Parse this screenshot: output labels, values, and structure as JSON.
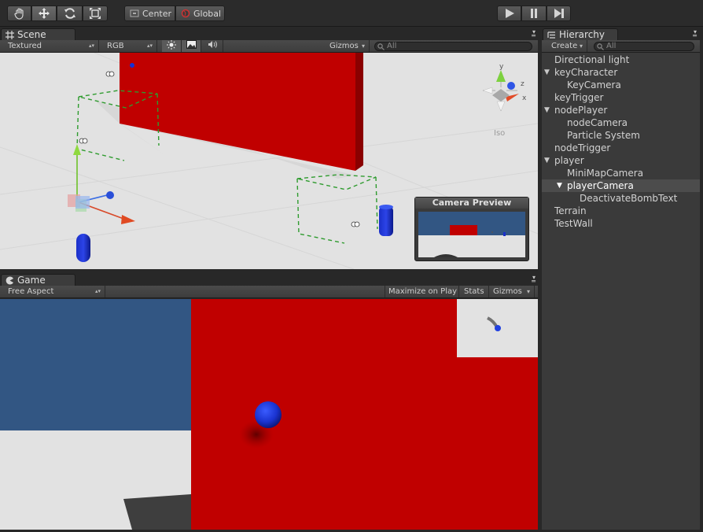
{
  "toolbar": {
    "tools": [
      {
        "name": "hand-tool",
        "icon": "hand-icon",
        "active": false
      },
      {
        "name": "move-tool",
        "icon": "move-arrows-icon",
        "active": true
      },
      {
        "name": "rotate-tool",
        "icon": "rotate-icon",
        "active": false
      },
      {
        "name": "scale-tool",
        "icon": "scale-icon",
        "active": false
      }
    ],
    "pivot_label": "Center",
    "space_label": "Global",
    "playback": [
      {
        "name": "play-button",
        "icon": "play-icon"
      },
      {
        "name": "pause-button",
        "icon": "pause-icon"
      },
      {
        "name": "step-button",
        "icon": "step-icon"
      }
    ]
  },
  "scene": {
    "tab_label": "Scene",
    "draw_mode": "Textured",
    "render_mode": "RGB",
    "gizmos_label": "Gizmos",
    "search_placeholder": "All",
    "iso_label": "Iso",
    "axes": {
      "y": "y",
      "z": "z",
      "x": "x"
    },
    "camera_preview_title": "Camera Preview"
  },
  "game": {
    "tab_label": "Game",
    "aspect": "Free Aspect",
    "maximize_label": "Maximize on Play",
    "stats_label": "Stats",
    "gizmos_label": "Gizmos"
  },
  "hierarchy": {
    "tab_label": "Hierarchy",
    "create_label": "Create",
    "search_placeholder": "All",
    "items": [
      {
        "label": "Directional light",
        "depth": 0,
        "fold": "",
        "selected": false
      },
      {
        "label": "keyCharacter",
        "depth": 0,
        "fold": "open",
        "selected": false
      },
      {
        "label": "KeyCamera",
        "depth": 1,
        "fold": "",
        "selected": false
      },
      {
        "label": "keyTrigger",
        "depth": 0,
        "fold": "",
        "selected": false
      },
      {
        "label": "nodePlayer",
        "depth": 0,
        "fold": "open",
        "selected": false
      },
      {
        "label": "nodeCamera",
        "depth": 1,
        "fold": "",
        "selected": false
      },
      {
        "label": "Particle System",
        "depth": 1,
        "fold": "",
        "selected": false
      },
      {
        "label": "nodeTrigger",
        "depth": 0,
        "fold": "",
        "selected": false
      },
      {
        "label": "player",
        "depth": 0,
        "fold": "open",
        "selected": false
      },
      {
        "label": "MiniMapCamera",
        "depth": 1,
        "fold": "",
        "selected": false
      },
      {
        "label": "playerCamera",
        "depth": 1,
        "fold": "open",
        "selected": true
      },
      {
        "label": "DeactivateBombText",
        "depth": 2,
        "fold": "",
        "selected": false
      },
      {
        "label": "Terrain",
        "depth": 0,
        "fold": "",
        "selected": false
      },
      {
        "label": "TestWall",
        "depth": 0,
        "fold": "",
        "selected": false
      }
    ]
  },
  "colors": {
    "wall_red": "#c00000",
    "sky_blue": "#325683",
    "ground": "#e2e2e2",
    "selection": "#4c4c4c",
    "panel_bg": "#3a3a3a"
  }
}
